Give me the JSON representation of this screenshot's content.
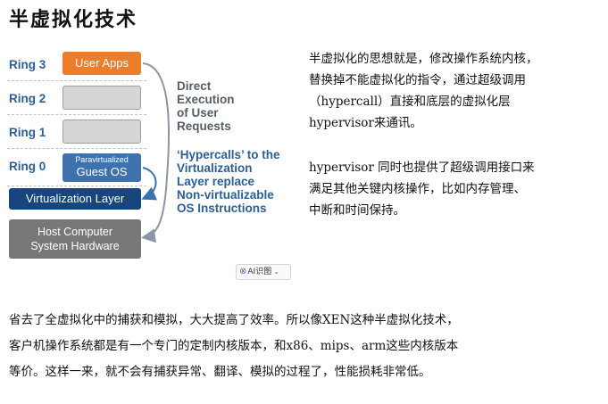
{
  "heading": "半虚拟化技术",
  "diagram": {
    "rings": [
      "Ring 3",
      "Ring 2",
      "Ring 1",
      "Ring 0"
    ],
    "user_apps": "User Apps",
    "guest_small": "Paravirtualized",
    "guest_big": "Guest OS",
    "virt_layer": "Virtualization Layer",
    "host_line1": "Host Computer",
    "host_line2": "System Hardware",
    "direct_lines": [
      "Direct",
      "Execution",
      "of User",
      "Requests"
    ],
    "hyper_lines": [
      "‘Hypercalls’ to the",
      "Virtualization",
      "Layer replace",
      "Non-virtualizable",
      "OS Instructions"
    ],
    "colors": {
      "ring_label": "#2c5f93",
      "user_apps": "#ec7d2a",
      "guest_os": "#3e72ad",
      "virt_layer": "#17457d",
      "host": "#787878",
      "direct_text": "#555d66",
      "hyper_text": "#2c5f93"
    }
  },
  "ai_badge": {
    "icon": "ai-scan-icon",
    "label": "AI识图",
    "chevron": "chevron-down-icon"
  },
  "right_text": {
    "p1": [
      "半虚拟化的思想就是，修改操作系统内核，",
      "替换掉不能虚拟化的指令，通过超级调用",
      "（hypercall）直接和底层的虚拟化层",
      "hypervisor来通讯。"
    ],
    "p2": [
      "hypervisor 同时也提供了超级调用接口来",
      "满足其他关键内核操作，比如内存管理、",
      "中断和时间保持。"
    ]
  },
  "bottom_text": [
    "省去了全虚拟化中的捕获和模拟，大大提高了效率。所以像XEN这种半虚拟化技术，",
    "客户机操作系统都是有一个专门的定制内核版本，和x86、mips、arm这些内核版本",
    "等价。这样一来，就不会有捕获异常、翻译、模拟的过程了，性能损耗非常低。"
  ]
}
